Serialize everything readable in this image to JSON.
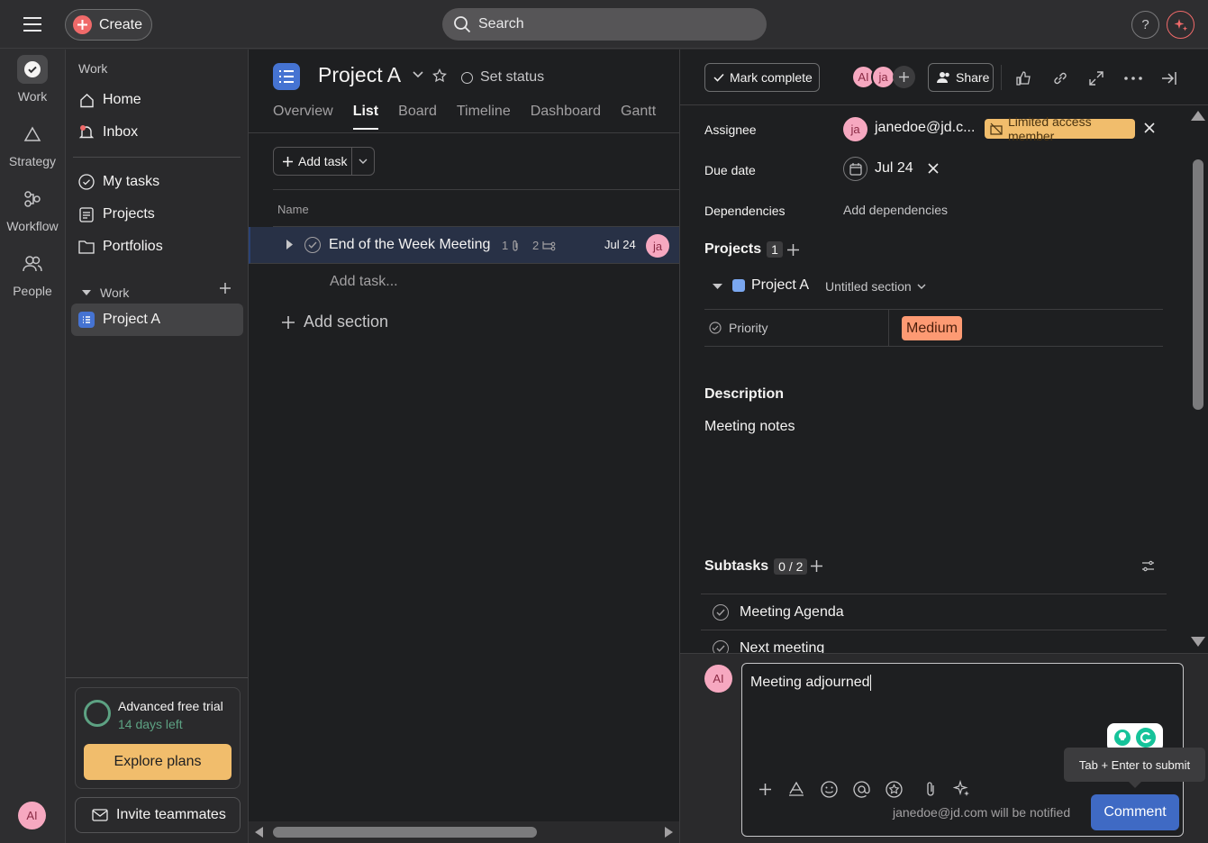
{
  "topbar": {
    "create_label": "Create",
    "search_placeholder": "Search",
    "help_label": "?"
  },
  "rail": {
    "items": [
      {
        "label": "Work",
        "icon": "check-circle-icon"
      },
      {
        "label": "Strategy",
        "icon": "triangle-icon"
      },
      {
        "label": "Workflow",
        "icon": "workflow-icon"
      },
      {
        "label": "People",
        "icon": "people-icon"
      }
    ],
    "user_initials": "AI"
  },
  "sidebar": {
    "section_work": "Work",
    "home": "Home",
    "inbox": "Inbox",
    "my_tasks": "My tasks",
    "projects": "Projects",
    "portfolios": "Portfolios",
    "team_section": "Work",
    "project_a": "Project A",
    "trial": {
      "title": "Advanced free trial",
      "days_left": "14 days left",
      "cta": "Explore plans"
    },
    "invite": "Invite teammates"
  },
  "project": {
    "title": "Project A",
    "set_status": "Set status",
    "tabs": [
      "Overview",
      "List",
      "Board",
      "Timeline",
      "Dashboard",
      "Gantt"
    ],
    "active_tab": "List",
    "add_task": "Add task",
    "col_name": "Name",
    "task": {
      "name": "End of the Week Meeting",
      "attachments": "1",
      "subtasks": "2",
      "due": "Jul 24",
      "assignee_initials": "ja"
    },
    "add_task_placeholder": "Add task...",
    "add_section": "Add section"
  },
  "detail": {
    "mark_complete": "Mark complete",
    "collaborators": [
      "AI",
      "ja"
    ],
    "share": "Share",
    "fields": {
      "assignee_label": "Assignee",
      "assignee_initials": "ja",
      "assignee_value": "janedoe@jd.c...",
      "limited_access": "Limited access member",
      "due_label": "Due date",
      "due_value": "Jul 24",
      "dependencies_label": "Dependencies",
      "dependencies_value": "Add dependencies",
      "projects_label": "Projects",
      "projects_count": "1",
      "project_name": "Project A",
      "section_name": "Untitled section",
      "priority_label": "Priority",
      "priority_value": "Medium"
    },
    "description_label": "Description",
    "description_text": "Meeting notes",
    "subtasks_label": "Subtasks",
    "subtasks_count": "0 / 2",
    "subtasks": [
      "Meeting Agenda",
      "Next meeting"
    ],
    "comment": {
      "user_initials": "AI",
      "text": "Meeting adjourned",
      "tooltip": "Tab + Enter to submit",
      "notify": "janedoe@jd.com will be notified",
      "submit": "Comment"
    }
  },
  "colors": {
    "accent": "#4573d2",
    "create": "#f06a6a",
    "trial": "#f1bd6c",
    "priority": "#fd9a73",
    "submit": "#3f6ac4"
  }
}
